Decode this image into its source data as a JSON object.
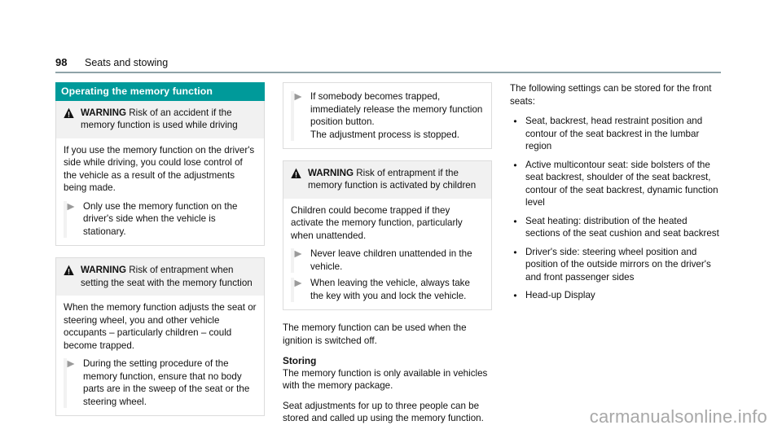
{
  "header": {
    "page_number": "98",
    "chapter_title": "Seats and stowing"
  },
  "section": {
    "heading": "Operating the memory function"
  },
  "icons": {
    "warning_triangle": "warning-triangle-icon",
    "step_arrow": "right-arrow-bullet-icon",
    "round_bullet": "•"
  },
  "left_column": {
    "warning_1": {
      "label": "WARNING",
      "title": " Risk of an accident if the memory function is used while driving",
      "paragraph": "If you use the memory function on the driver's side while driving, you could lose control of the vehicle as a result of the adjustments being made.",
      "steps": [
        "Only use the memory function on the driver's side when the vehicle is stationary."
      ]
    },
    "warning_2": {
      "label": "WARNING",
      "title": " Risk of entrapment when setting the seat with the memory function",
      "paragraph": "When the memory function adjusts the seat or steering wheel, you and other vehicle occupants – particularly children – could become trapped.",
      "steps": [
        "During the setting procedure of the memory function, ensure that no body parts are in the sweep of the seat or the steering wheel."
      ]
    }
  },
  "middle_column": {
    "continued_box": {
      "steps": [
        "If somebody becomes trapped, immediately release the memory function position button."
      ],
      "result": "The adjustment process is stopped."
    },
    "warning_3": {
      "label": "WARNING",
      "title": " Risk of entrapment if the memory function is activated by children",
      "paragraph": "Children could become trapped if they activate the memory function, particularly when unattended.",
      "steps": [
        "Never leave children unattended in the vehicle.",
        "When leaving the vehicle, always take the key with you and lock the vehicle."
      ]
    },
    "note": "The memory function can be used when the ignition is switched off.",
    "storing": {
      "subhead": "Storing",
      "paragraph_1": "The memory function is only available in vehicles with the memory package.",
      "paragraph_2": "Seat adjustments for up to three people can be stored and called up using the memory function."
    }
  },
  "right_column": {
    "intro": "The following settings can be stored for the front seats:",
    "settings": [
      "Seat, backrest, head restraint position and contour of the seat backrest in the lumbar region",
      "Active multicontour seat: side bolsters of the seat backrest, shoulder of the seat backrest, contour of the seat backrest, dynamic function level",
      "Seat heating: distribution of the heated sections of the seat cushion and seat backrest",
      "Driver's side: steering wheel position and position of the outside mirrors on the driver's and front passenger sides",
      "Head-up Display"
    ]
  },
  "watermark": {
    "text": "carmanualsonline.info"
  },
  "colors": {
    "section_bar": "#009a9a",
    "header_rule": "#8fa3a8",
    "warning_head_bg": "#f1f1f1",
    "box_border": "#dcdcdc",
    "step_arrow": "#9a9a9a",
    "watermark": "#a8a8a8"
  }
}
